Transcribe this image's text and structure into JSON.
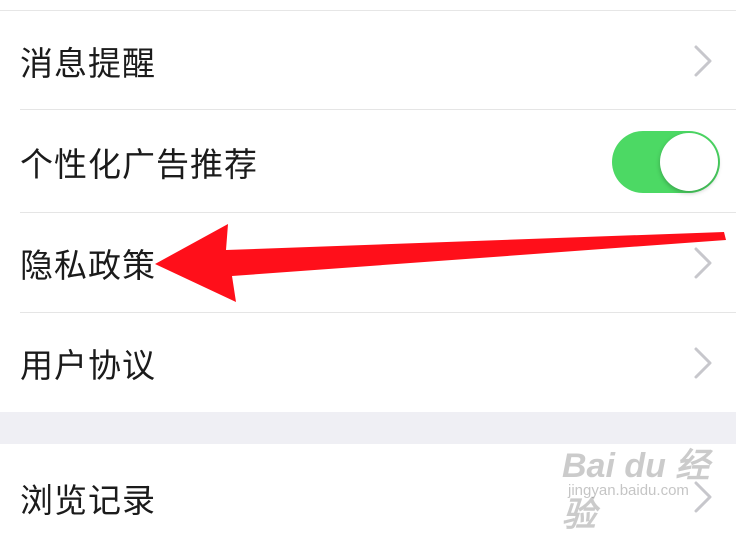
{
  "settings": {
    "items": [
      {
        "label": "消息提醒",
        "control": "chevron"
      },
      {
        "label": "个性化广告推荐",
        "control": "toggle",
        "toggle_on": true
      },
      {
        "label": "隐私政策",
        "control": "chevron"
      },
      {
        "label": "用户协议",
        "control": "chevron"
      },
      {
        "label": "浏览记录",
        "control": "chevron"
      }
    ]
  },
  "watermark": {
    "brand": "Bai du 经验",
    "url": "jingyan.baidu.com"
  },
  "colors": {
    "toggle_on": "#4cd964",
    "annotation_arrow": "#ff0f1a",
    "section_gap": "#efeff4"
  }
}
